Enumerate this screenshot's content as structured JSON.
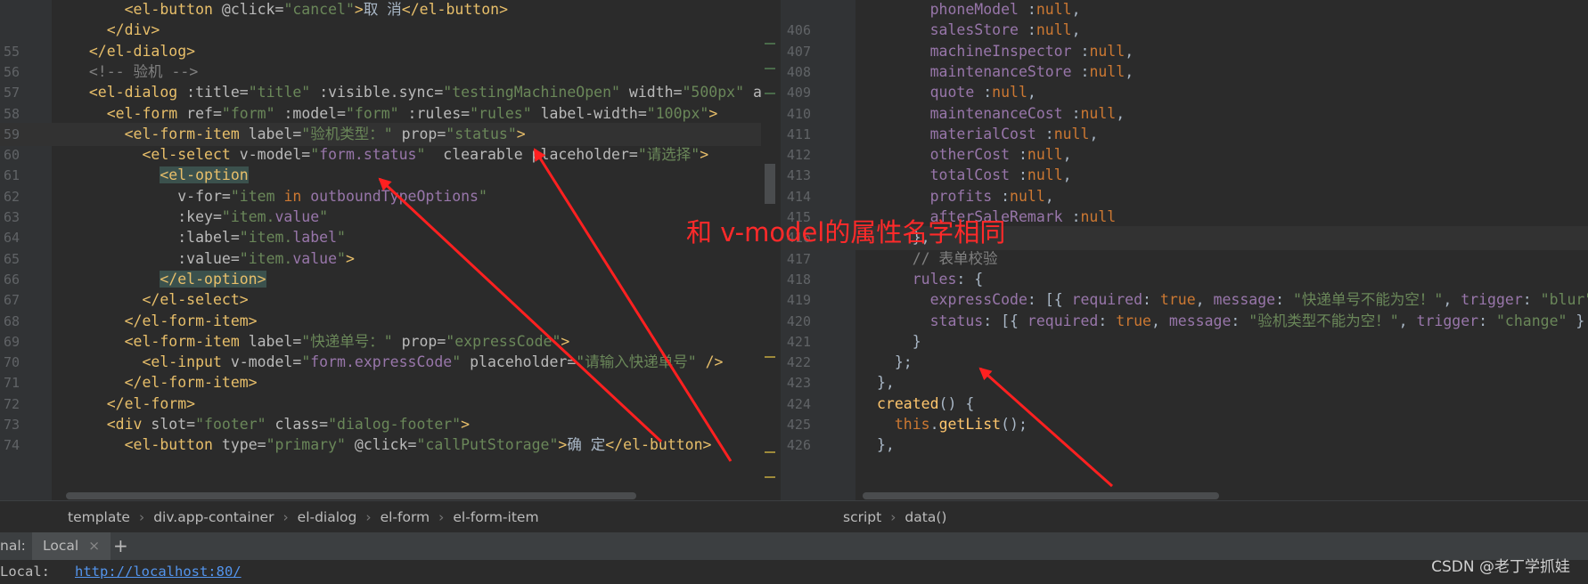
{
  "left_editor": {
    "lines": [
      {
        "num": "",
        "segs": [
          [
            "pl",
            "      "
          ],
          [
            "tag",
            "<el-button "
          ],
          [
            "attr",
            "@click="
          ],
          [
            "str",
            "\"cancel\""
          ],
          [
            "tag",
            ">"
          ],
          [
            "pl",
            "取 消"
          ],
          [
            "tag",
            "</el-button>"
          ]
        ]
      },
      {
        "num": "",
        "segs": [
          [
            "pl",
            "    "
          ],
          [
            "tag",
            "</div>"
          ]
        ]
      },
      {
        "num": "55",
        "segs": [
          [
            "pl",
            "  "
          ],
          [
            "tag",
            "</el-dialog>"
          ]
        ]
      },
      {
        "num": "56",
        "segs": [
          [
            "cmt",
            "  <!-- 验机 -->"
          ]
        ]
      },
      {
        "num": "57",
        "segs": [
          [
            "pl",
            "  "
          ],
          [
            "tag",
            "<el-dialog "
          ],
          [
            "attr",
            ":title="
          ],
          [
            "str",
            "\"title\" "
          ],
          [
            "attr",
            ":visible.sync="
          ],
          [
            "str",
            "\"testingMachineOpen\" "
          ],
          [
            "attr",
            "width="
          ],
          [
            "str",
            "\"500px\" "
          ],
          [
            "attr",
            "a"
          ]
        ]
      },
      {
        "num": "58",
        "segs": [
          [
            "pl",
            "    "
          ],
          [
            "tag",
            "<el-form "
          ],
          [
            "attr",
            "ref="
          ],
          [
            "str",
            "\"form\" "
          ],
          [
            "attr",
            ":model="
          ],
          [
            "str",
            "\"form\" "
          ],
          [
            "attr",
            ":rules="
          ],
          [
            "str",
            "\"rules\" "
          ],
          [
            "attr",
            "label-width="
          ],
          [
            "str",
            "\"100px\""
          ],
          [
            "tag",
            ">"
          ]
        ]
      },
      {
        "num": "59",
        "segs": [
          [
            "pl",
            "      "
          ],
          [
            "tag",
            "<el-form-item "
          ],
          [
            "attr",
            "label="
          ],
          [
            "str",
            "\"验机类型：\" "
          ],
          [
            "attr",
            "prop="
          ],
          [
            "str",
            "\"status\""
          ],
          [
            "tag",
            ">"
          ]
        ]
      },
      {
        "num": "60",
        "segs": [
          [
            "pl",
            "        "
          ],
          [
            "tag",
            "<el-select "
          ],
          [
            "attr",
            "v-model="
          ],
          [
            "str",
            "\""
          ],
          [
            "prop",
            "form.status"
          ],
          [
            "str",
            "\"  "
          ],
          [
            "attr",
            "clearable "
          ],
          [
            "attr",
            "placeholder="
          ],
          [
            "str",
            "\"请选择\""
          ],
          [
            "tag",
            ">"
          ]
        ]
      },
      {
        "num": "61",
        "segs": [
          [
            "pl",
            "          "
          ],
          [
            "tag",
            "<el-option"
          ]
        ]
      },
      {
        "num": "62",
        "segs": [
          [
            "pl",
            "            "
          ],
          [
            "attr",
            "v-for="
          ],
          [
            "str",
            "\"item "
          ],
          [
            "kw",
            "in "
          ],
          [
            "prop",
            "outboundTypeOptions"
          ],
          [
            "str",
            "\""
          ]
        ]
      },
      {
        "num": "63",
        "segs": [
          [
            "pl",
            "            "
          ],
          [
            "attr",
            ":key="
          ],
          [
            "str",
            "\"item."
          ],
          [
            "prop",
            "value"
          ],
          [
            "str",
            "\""
          ]
        ]
      },
      {
        "num": "64",
        "segs": [
          [
            "pl",
            "            "
          ],
          [
            "attr",
            ":label="
          ],
          [
            "str",
            "\"item."
          ],
          [
            "prop",
            "label"
          ],
          [
            "str",
            "\""
          ]
        ]
      },
      {
        "num": "65",
        "segs": [
          [
            "pl",
            "            "
          ],
          [
            "attr",
            ":value="
          ],
          [
            "str",
            "\"item."
          ],
          [
            "prop",
            "value"
          ],
          [
            "str",
            "\""
          ],
          [
            "tag",
            ">"
          ]
        ]
      },
      {
        "num": "66",
        "segs": [
          [
            "pl",
            "          "
          ],
          [
            "tag",
            "</el-option>"
          ]
        ]
      },
      {
        "num": "67",
        "segs": [
          [
            "pl",
            "        "
          ],
          [
            "tag",
            "</el-select>"
          ]
        ]
      },
      {
        "num": "68",
        "segs": [
          [
            "pl",
            "      "
          ],
          [
            "tag",
            "</el-form-item>"
          ]
        ]
      },
      {
        "num": "69",
        "segs": [
          [
            "pl",
            "      "
          ],
          [
            "tag",
            "<el-form-item "
          ],
          [
            "attr",
            "label="
          ],
          [
            "str",
            "\"快递单号：\" "
          ],
          [
            "attr",
            "prop="
          ],
          [
            "str",
            "\"expressCode\""
          ],
          [
            "tag",
            ">"
          ]
        ]
      },
      {
        "num": "70",
        "segs": [
          [
            "pl",
            "        "
          ],
          [
            "tag",
            "<el-input "
          ],
          [
            "attr",
            "v-model="
          ],
          [
            "str",
            "\""
          ],
          [
            "prop",
            "form.expressCode"
          ],
          [
            "str",
            "\" "
          ],
          [
            "attr",
            "placeholder="
          ],
          [
            "str",
            "\"请输入快递单号\" "
          ],
          [
            "tag",
            "/>"
          ]
        ]
      },
      {
        "num": "71",
        "segs": [
          [
            "pl",
            "      "
          ],
          [
            "tag",
            "</el-form-item>"
          ]
        ]
      },
      {
        "num": "72",
        "segs": [
          [
            "pl",
            "    "
          ],
          [
            "tag",
            "</el-form>"
          ]
        ]
      },
      {
        "num": "73",
        "segs": [
          [
            "pl",
            "    "
          ],
          [
            "tag",
            "<div "
          ],
          [
            "attr",
            "slot="
          ],
          [
            "str",
            "\"footer\" "
          ],
          [
            "attr",
            "class="
          ],
          [
            "str",
            "\"dialog-footer\""
          ],
          [
            "tag",
            ">"
          ]
        ]
      },
      {
        "num": "74",
        "segs": [
          [
            "pl",
            "      "
          ],
          [
            "tag",
            "<el-button "
          ],
          [
            "attr",
            "type="
          ],
          [
            "str",
            "\"primary\" "
          ],
          [
            "attr",
            "@click="
          ],
          [
            "str",
            "\"callPutStorage\""
          ],
          [
            "tag",
            ">"
          ],
          [
            "pl",
            "确 定"
          ],
          [
            "tag",
            "</el-button>"
          ]
        ]
      }
    ]
  },
  "right_editor": {
    "lines": [
      {
        "num": "",
        "segs": [
          [
            "pl",
            "      "
          ],
          [
            "prop",
            "phoneModel "
          ],
          [
            "pl",
            ":"
          ],
          [
            "kw",
            "null"
          ],
          [
            "pl",
            ","
          ]
        ]
      },
      {
        "num": "406",
        "segs": [
          [
            "pl",
            "      "
          ],
          [
            "prop",
            "salesStore "
          ],
          [
            "pl",
            ":"
          ],
          [
            "kw",
            "null"
          ],
          [
            "pl",
            ","
          ]
        ]
      },
      {
        "num": "407",
        "segs": [
          [
            "pl",
            "      "
          ],
          [
            "prop",
            "machineInspector "
          ],
          [
            "pl",
            ":"
          ],
          [
            "kw",
            "null"
          ],
          [
            "pl",
            ","
          ]
        ]
      },
      {
        "num": "408",
        "segs": [
          [
            "pl",
            "      "
          ],
          [
            "prop",
            "maintenanceStore "
          ],
          [
            "pl",
            ":"
          ],
          [
            "kw",
            "null"
          ],
          [
            "pl",
            ","
          ]
        ]
      },
      {
        "num": "409",
        "segs": [
          [
            "pl",
            "      "
          ],
          [
            "prop",
            "quote "
          ],
          [
            "pl",
            ":"
          ],
          [
            "kw",
            "null"
          ],
          [
            "pl",
            ","
          ]
        ]
      },
      {
        "num": "410",
        "segs": [
          [
            "pl",
            "      "
          ],
          [
            "prop",
            "maintenanceCost "
          ],
          [
            "pl",
            ":"
          ],
          [
            "kw",
            "null"
          ],
          [
            "pl",
            ","
          ]
        ]
      },
      {
        "num": "411",
        "segs": [
          [
            "pl",
            "      "
          ],
          [
            "prop",
            "materialCost "
          ],
          [
            "pl",
            ":"
          ],
          [
            "kw",
            "null"
          ],
          [
            "pl",
            ","
          ]
        ]
      },
      {
        "num": "412",
        "segs": [
          [
            "pl",
            "      "
          ],
          [
            "prop",
            "otherCost "
          ],
          [
            "pl",
            ":"
          ],
          [
            "kw",
            "null"
          ],
          [
            "pl",
            ","
          ]
        ]
      },
      {
        "num": "413",
        "segs": [
          [
            "pl",
            "      "
          ],
          [
            "prop",
            "totalCost "
          ],
          [
            "pl",
            ":"
          ],
          [
            "kw",
            "null"
          ],
          [
            "pl",
            ","
          ]
        ]
      },
      {
        "num": "414",
        "segs": [
          [
            "pl",
            "      "
          ],
          [
            "prop",
            "profits "
          ],
          [
            "pl",
            ":"
          ],
          [
            "kw",
            "null"
          ],
          [
            "pl",
            ","
          ]
        ]
      },
      {
        "num": "415",
        "segs": [
          [
            "pl",
            "      "
          ],
          [
            "prop",
            "afterSaleRemark "
          ],
          [
            "pl",
            ":"
          ],
          [
            "kw",
            "null"
          ]
        ]
      },
      {
        "num": "416",
        "segs": [
          [
            "pl",
            "    },"
          ]
        ]
      },
      {
        "num": "417",
        "segs": [
          [
            "cmt",
            "    // 表单校验"
          ]
        ]
      },
      {
        "num": "418",
        "segs": [
          [
            "pl",
            "    "
          ],
          [
            "prop",
            "rules"
          ],
          [
            "pl",
            ": {"
          ]
        ]
      },
      {
        "num": "419",
        "segs": [
          [
            "pl",
            "      "
          ],
          [
            "prop",
            "expressCode"
          ],
          [
            "pl",
            ": [{ "
          ],
          [
            "prop",
            "required"
          ],
          [
            "pl",
            ": "
          ],
          [
            "kw",
            "true"
          ],
          [
            "pl",
            ", "
          ],
          [
            "prop",
            "message"
          ],
          [
            "pl",
            ": "
          ],
          [
            "str",
            "\"快递单号不能为空！\""
          ],
          [
            "pl",
            ", "
          ],
          [
            "prop",
            "trigger"
          ],
          [
            "pl",
            ": "
          ],
          [
            "str",
            "\"blur\""
          ]
        ]
      },
      {
        "num": "420",
        "segs": [
          [
            "pl",
            "      "
          ],
          [
            "prop",
            "status"
          ],
          [
            "pl",
            ": [{ "
          ],
          [
            "prop",
            "required"
          ],
          [
            "pl",
            ": "
          ],
          [
            "kw",
            "true"
          ],
          [
            "pl",
            ", "
          ],
          [
            "prop",
            "message"
          ],
          [
            "pl",
            ": "
          ],
          [
            "str",
            "\"验机类型不能为空！\""
          ],
          [
            "pl",
            ", "
          ],
          [
            "prop",
            "trigger"
          ],
          [
            "pl",
            ": "
          ],
          [
            "str",
            "\"change\""
          ],
          [
            "pl",
            " }"
          ]
        ]
      },
      {
        "num": "421",
        "segs": [
          [
            "pl",
            "    }"
          ]
        ]
      },
      {
        "num": "422",
        "segs": [
          [
            "pl",
            "  };"
          ]
        ]
      },
      {
        "num": "423",
        "segs": [
          [
            "pl",
            "},"
          ]
        ]
      },
      {
        "num": "424",
        "segs": [
          [
            "fn",
            "created"
          ],
          [
            "pl",
            "() {"
          ]
        ]
      },
      {
        "num": "425",
        "segs": [
          [
            "pl",
            "  "
          ],
          [
            "kw",
            "this"
          ],
          [
            "pl",
            "."
          ],
          [
            "fn",
            "getList"
          ],
          [
            "pl",
            "();"
          ]
        ]
      },
      {
        "num": "426",
        "segs": [
          [
            "pl",
            "},"
          ]
        ]
      }
    ]
  },
  "breadcrumb_left": [
    "template",
    "div.app-container",
    "el-dialog",
    "el-form",
    "el-form-item"
  ],
  "breadcrumb_right": [
    "script",
    "data()"
  ],
  "terminal": {
    "title": "nal:",
    "tab_label": "Local",
    "close_icon": "×",
    "add_icon": "+",
    "output_label": "Local:",
    "output_link": "http://localhost:80/"
  },
  "annotation": {
    "text": "和 v-model的属性名字相同",
    "color": "#ff2a2a"
  },
  "watermark": "CSDN @老丁学抓娃",
  "colors": {
    "tag": "#e8bf6a",
    "string": "#6a8759",
    "keyword": "#cc7832",
    "property": "#9876aa",
    "comment": "#808080",
    "background": "#2b2b2b"
  }
}
